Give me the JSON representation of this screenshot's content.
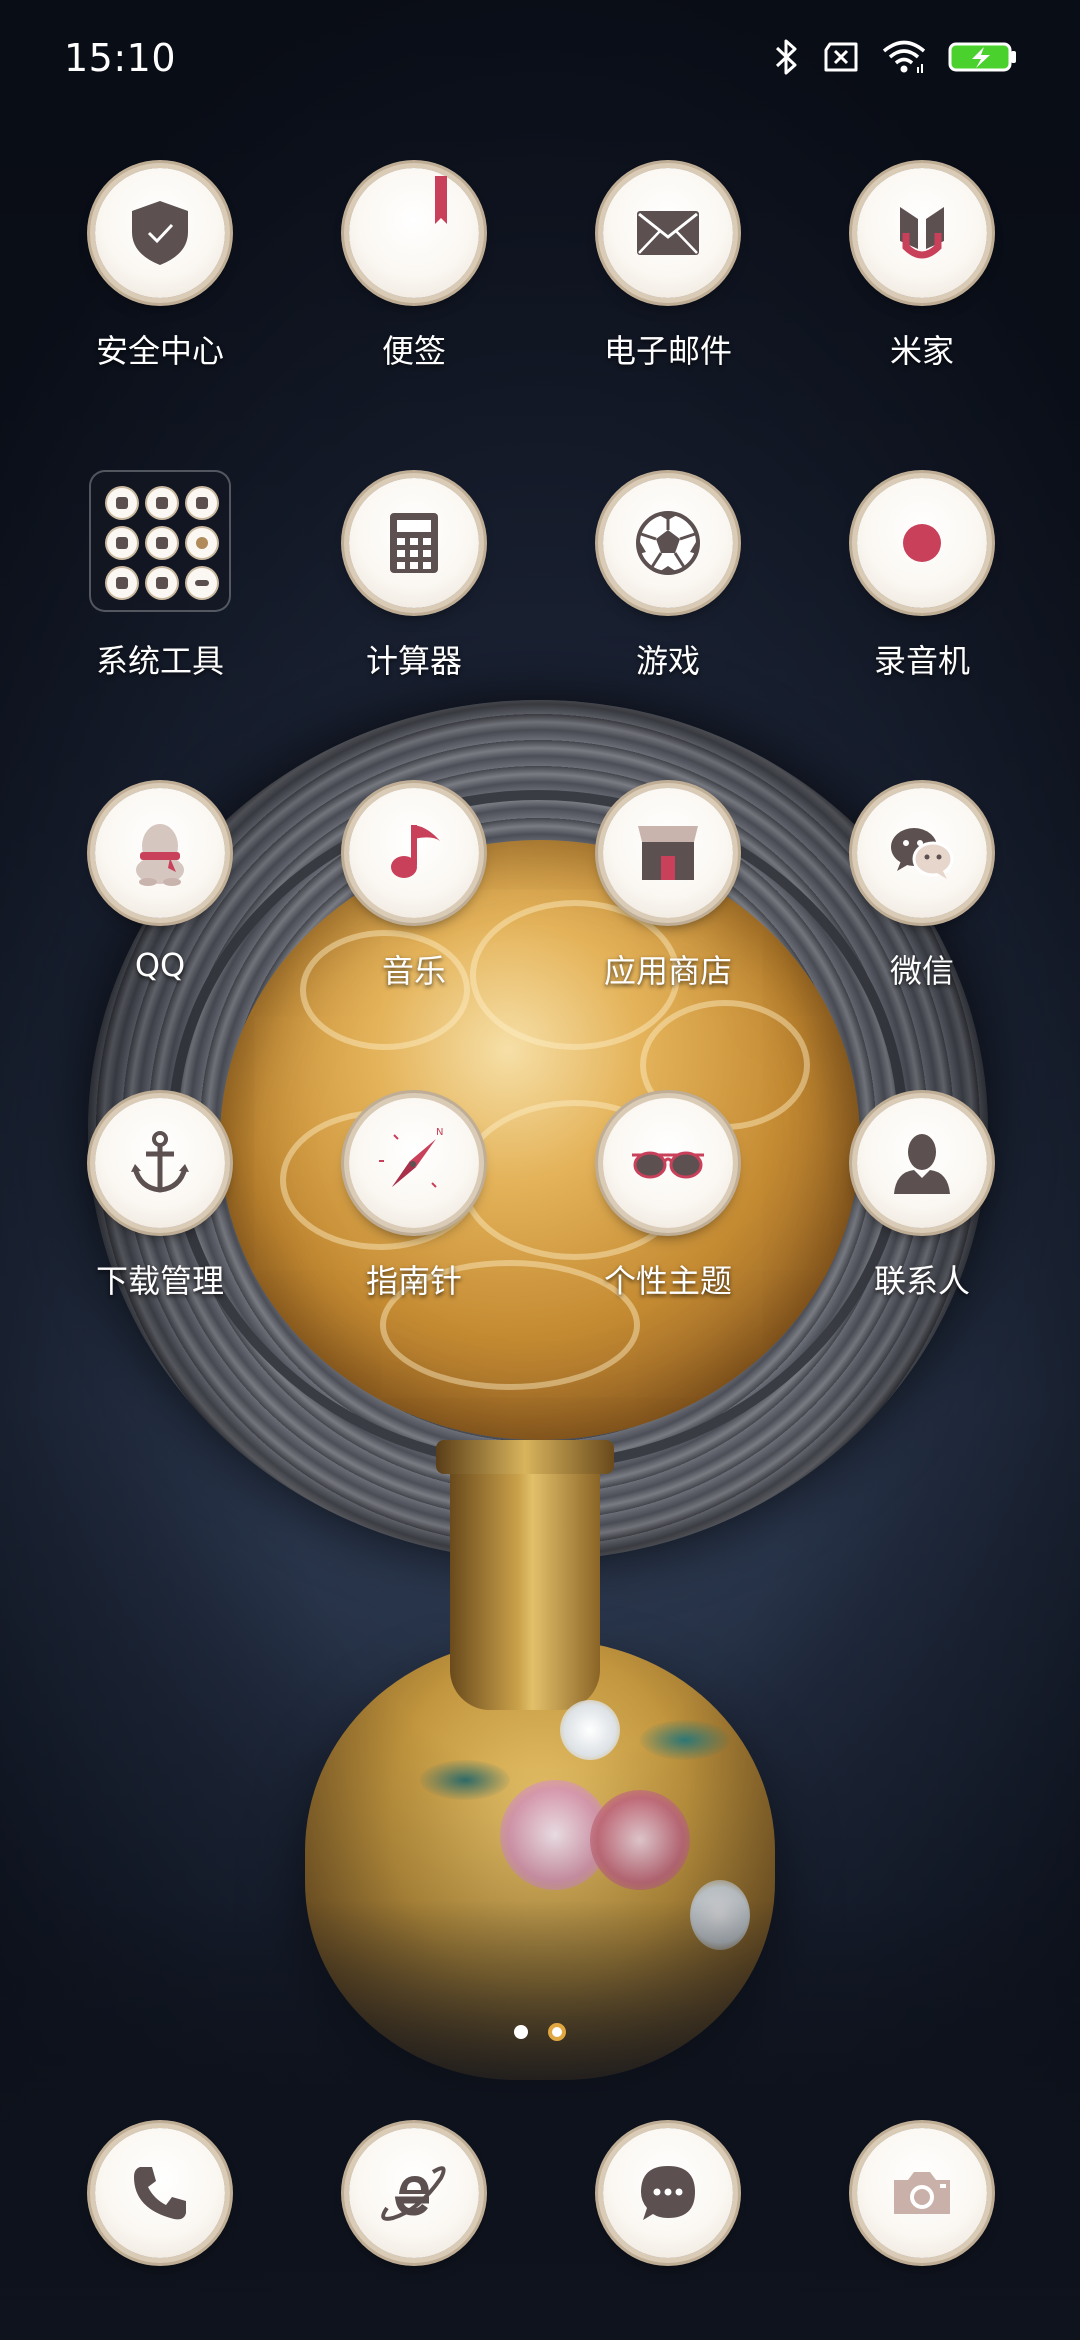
{
  "status_bar": {
    "time": "15:10",
    "icons": [
      "bluetooth-icon",
      "no-sim-icon",
      "wifi-icon",
      "battery-charging-icon"
    ]
  },
  "home": {
    "apps": [
      {
        "label": "安全中心",
        "icon": "shield-icon"
      },
      {
        "label": "便签",
        "icon": "notes-icon"
      },
      {
        "label": "电子邮件",
        "icon": "mail-icon"
      },
      {
        "label": "米家",
        "icon": "mijia-icon"
      },
      {
        "label": "系统工具",
        "icon": "folder-icon"
      },
      {
        "label": "计算器",
        "icon": "calculator-icon"
      },
      {
        "label": "游戏",
        "icon": "soccer-ball-icon"
      },
      {
        "label": "录音机",
        "icon": "recorder-icon"
      },
      {
        "label": "QQ",
        "icon": "qq-icon"
      },
      {
        "label": "音乐",
        "icon": "music-note-icon"
      },
      {
        "label": "应用商店",
        "icon": "store-icon"
      },
      {
        "label": "微信",
        "icon": "wechat-icon"
      },
      {
        "label": "下载管理",
        "icon": "anchor-icon"
      },
      {
        "label": "指南针",
        "icon": "compass-icon"
      },
      {
        "label": "个性主题",
        "icon": "sunglasses-icon"
      },
      {
        "label": "联系人",
        "icon": "contact-person-icon"
      }
    ]
  },
  "page_indicator": {
    "pages": 2,
    "current": 2
  },
  "dock": [
    "phone-icon",
    "browser-icon",
    "messages-icon",
    "camera-icon"
  ],
  "colors": {
    "icon_glyph": "#5c5050",
    "accent_red": "#c8405a",
    "page_dot_active": "#e0a640",
    "battery_green": "#4bd12e"
  }
}
